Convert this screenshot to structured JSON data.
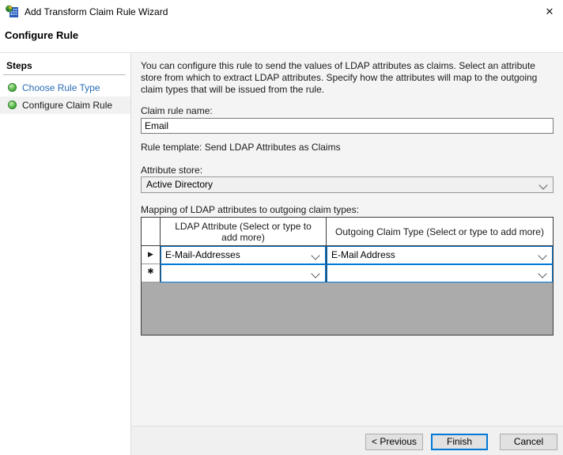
{
  "window": {
    "title": "Add Transform Claim Rule Wizard",
    "close_icon": "✕"
  },
  "header": {
    "title": "Configure Rule"
  },
  "sidebar": {
    "title": "Steps",
    "items": [
      {
        "label": "Choose Rule Type"
      },
      {
        "label": "Configure Claim Rule"
      }
    ]
  },
  "content": {
    "description": "You can configure this rule to send the values of LDAP attributes as claims. Select an attribute store from which to extract LDAP attributes. Specify how the attributes will map to the outgoing claim types that will be issued from the rule.",
    "claim_rule_name": {
      "label": "Claim rule name:",
      "value": "Email"
    },
    "rule_template": "Rule template: Send LDAP Attributes as Claims",
    "attribute_store": {
      "label": "Attribute store:",
      "value": "Active Directory"
    },
    "mapping": {
      "label": "Mapping of LDAP attributes to outgoing claim types:",
      "columns": [
        "LDAP Attribute (Select or type to add more)",
        "Outgoing Claim Type (Select or type to add more)"
      ],
      "rows": [
        {
          "selector": "▶",
          "ldap_attribute": "E-Mail-Addresses",
          "outgoing_claim_type": "E-Mail Address"
        },
        {
          "selector": "✱",
          "ldap_attribute": "",
          "outgoing_claim_type": ""
        }
      ]
    }
  },
  "footer": {
    "previous_label": "< Previous",
    "finish_label": "Finish",
    "cancel_label": "Cancel"
  },
  "colors": {
    "accent": "#0078d7",
    "link_blue": "#2a6db4",
    "step_bullet_green": "#52b848",
    "grid_fill_gray": "#ababab",
    "content_bg": "#f4f4f4"
  }
}
